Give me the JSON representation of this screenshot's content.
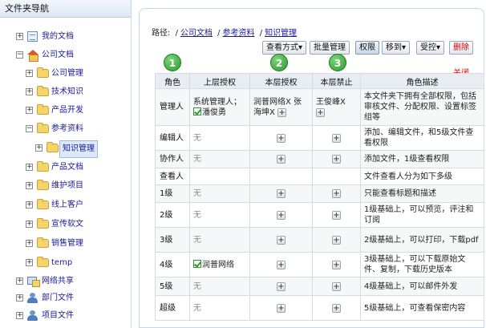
{
  "tree": {
    "header": "文件夹导航",
    "items": [
      {
        "label": "我的文档",
        "exp": "+",
        "icon": "doc-icon"
      },
      {
        "label": "公司文档",
        "exp": "−",
        "icon": "home-icon"
      },
      {
        "label": "公司管理",
        "exp": "+",
        "icon": "folder-icon"
      },
      {
        "label": "技术知识",
        "exp": "+",
        "icon": "folder-icon"
      },
      {
        "label": "产品开发",
        "exp": "+",
        "icon": "folder-icon"
      },
      {
        "label": "参考资料",
        "exp": "−",
        "icon": "folder-icon"
      },
      {
        "label": "知识管理",
        "exp": "+",
        "icon": "folder-icon"
      },
      {
        "label": "产品文档",
        "exp": "+",
        "icon": "folder-icon"
      },
      {
        "label": "维护项目",
        "exp": "+",
        "icon": "folder-icon"
      },
      {
        "label": "线上客户",
        "exp": "+",
        "icon": "folder-icon"
      },
      {
        "label": "宣传软文",
        "exp": "+",
        "icon": "folder-icon"
      },
      {
        "label": "销售管理",
        "exp": "+",
        "icon": "folder-icon"
      },
      {
        "label": "temp",
        "exp": "+",
        "icon": "folder-icon"
      },
      {
        "label": "网络共享",
        "exp": "+",
        "icon": "network-share-icon"
      },
      {
        "label": "部门文件",
        "exp": "+",
        "icon": "people-icon"
      },
      {
        "label": "项目文件",
        "exp": "+",
        "icon": "people-icon"
      }
    ]
  },
  "path": {
    "label": "路径:",
    "crumbs": [
      "公司文档",
      "参考资料",
      "知识管理"
    ]
  },
  "toolbar": {
    "view_mode": "查看方式▾",
    "batch_manage": "批量管理",
    "permission": "权限",
    "move_to": "移到▾",
    "controlled": "受控▾",
    "delete": "删除"
  },
  "close_label": "关闭",
  "steps": [
    "1",
    "2",
    "3"
  ],
  "table": {
    "headers": [
      "角色",
      "上层授权",
      "本层授权",
      "本层禁止",
      "角色描述"
    ],
    "rows": [
      {
        "role": "管理人",
        "upper": "系统管理人；",
        "upper2": "潘俊勇",
        "current": "润普网络X 张海坤X",
        "forbid": "王俊峰X",
        "desc": "本文件夹下拥有全部权限，包括审核文件、分配权限、设置标签组等"
      },
      {
        "role": "编辑人",
        "upper": "无",
        "desc": "添加、编辑文件，和5级文件查看权限"
      },
      {
        "role": "协作人",
        "upper": "无",
        "desc": "添加文件，1级查看权限"
      },
      {
        "role": "查看人",
        "upper": "",
        "desc": "文件查看人分为如下多级"
      },
      {
        "role": "1级",
        "upper": "无",
        "desc": "只能查看标题和描述"
      },
      {
        "role": "2级",
        "upper": "无",
        "desc": "1级基础上，可以预览，评注和订阅"
      },
      {
        "role": "3级",
        "upper": "无",
        "desc": "2级基础上，可以打印，下载pdf"
      },
      {
        "role": "4级",
        "upper": "润普网络",
        "desc": "3级基础上，可以下载原始文件、复制，下载历史版本"
      },
      {
        "role": "5级",
        "upper": "无",
        "desc": "4级基础上，可以邮件外发"
      },
      {
        "role": "超级",
        "upper": "无",
        "desc": "5级基础上，可查看保密内容"
      }
    ]
  },
  "colors": {
    "link": "#1a1a9a",
    "close": "#dd0000",
    "step": "#2d9a2d",
    "delete": "#cc0000"
  }
}
